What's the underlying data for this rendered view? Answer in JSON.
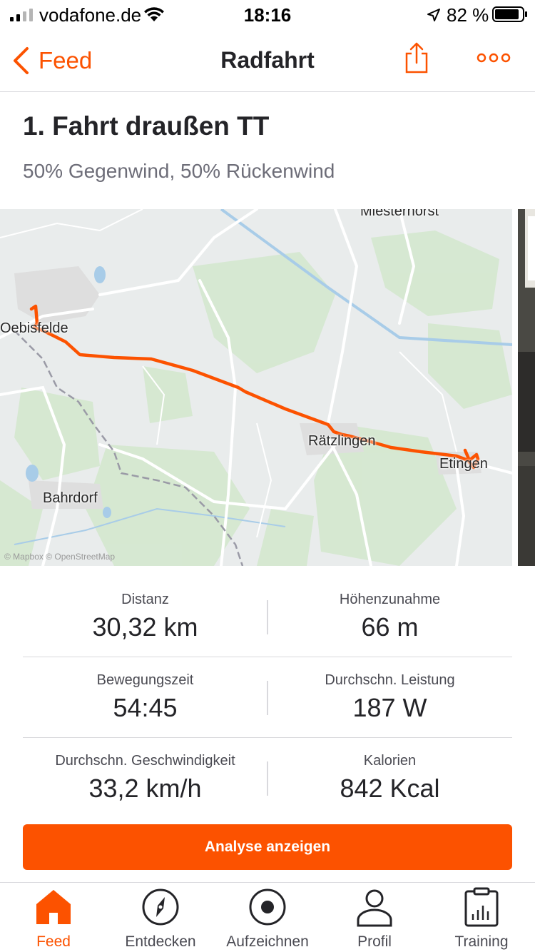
{
  "status_bar": {
    "carrier": "vodafone.de",
    "time": "18:16",
    "battery_percent": "82 %"
  },
  "nav": {
    "back_label": "Feed",
    "title": "Radfahrt"
  },
  "activity": {
    "title": "1. Fahrt draußen TT",
    "description": "50% Gegenwind, 50% Rückenwind"
  },
  "map": {
    "places": [
      "Miesterhorst",
      "Oebisfelde",
      "Rätzlingen",
      "Etingen",
      "Bahrdorf"
    ],
    "attribution": "© Mapbox © OpenStreetMap",
    "route_color": "#fc5200"
  },
  "stats": [
    {
      "label": "Distanz",
      "value": "30,32 km"
    },
    {
      "label": "Höhenzunahme",
      "value": "66 m"
    },
    {
      "label": "Bewegungszeit",
      "value": "54:45"
    },
    {
      "label": "Durchschn. Leistung",
      "value": "187 W"
    },
    {
      "label": "Durchschn. Geschwindigkeit",
      "value": "33,2 km/h"
    },
    {
      "label": "Kalorien",
      "value": "842 Kcal"
    }
  ],
  "analyse_button_label": "Analyse anzeigen",
  "tabs": [
    {
      "label": "Feed",
      "icon": "home-icon",
      "active": true
    },
    {
      "label": "Entdecken",
      "icon": "compass-icon",
      "active": false
    },
    {
      "label": "Aufzeichnen",
      "icon": "record-icon",
      "active": false
    },
    {
      "label": "Profil",
      "icon": "profile-icon",
      "active": false
    },
    {
      "label": "Training",
      "icon": "training-icon",
      "active": false
    }
  ],
  "colors": {
    "accent": "#fc5200",
    "text": "#242428",
    "secondary_text": "#6d6d78"
  }
}
